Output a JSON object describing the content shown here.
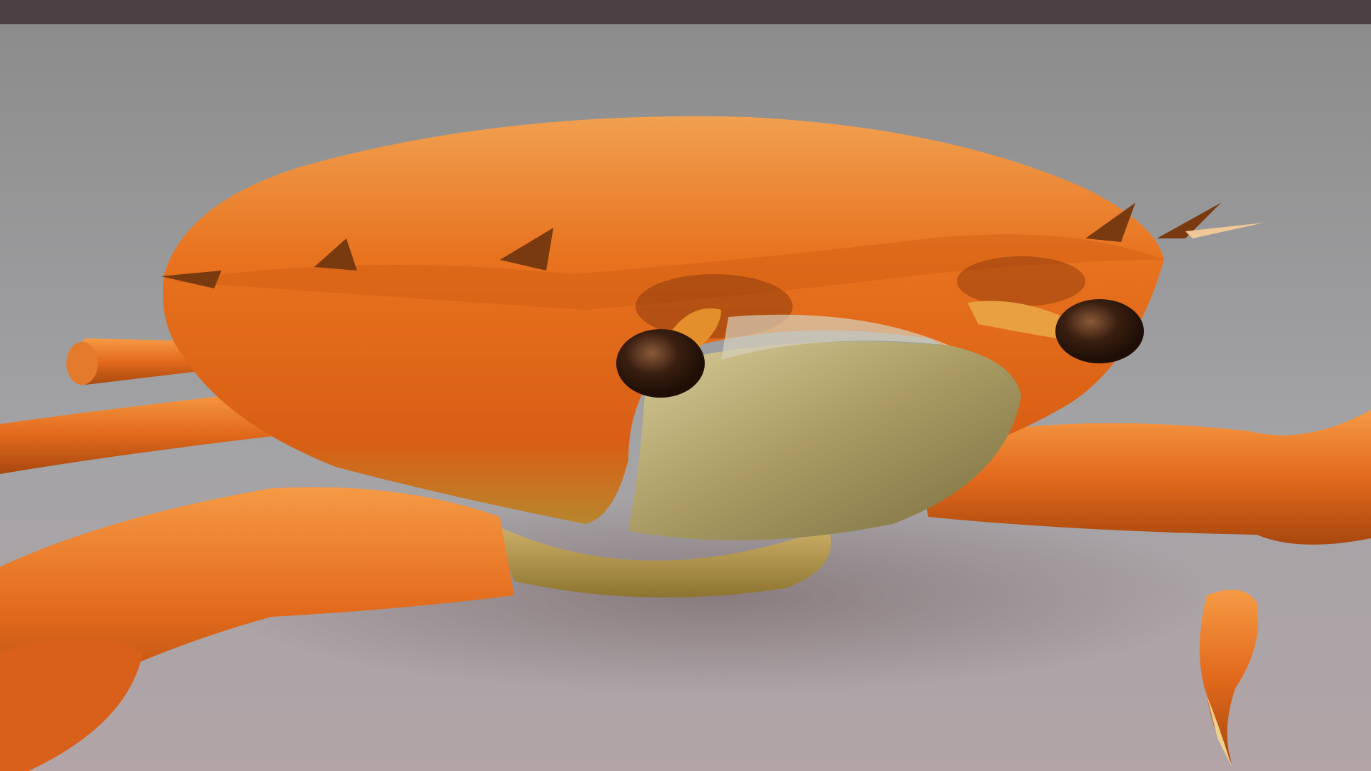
{
  "image": {
    "subject": "crab-3d-render",
    "colors": {
      "top_bar": "#4c4045",
      "background_top": "#8c8c8c",
      "background_bottom": "#b2a4a7",
      "shell_light": "#f08a2a",
      "shell_mid": "#e2661a",
      "shell_dark": "#a8420c",
      "underside": "#c2a86a",
      "plate": "#b9a96e",
      "eye": "#3a1f10"
    }
  }
}
